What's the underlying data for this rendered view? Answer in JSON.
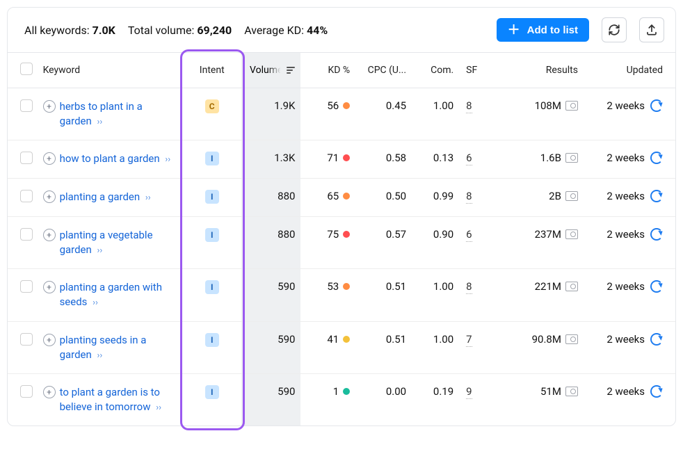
{
  "summary": {
    "all_keywords_label": "All keywords:",
    "all_keywords_value": "7.0K",
    "total_volume_label": "Total volume:",
    "total_volume_value": "69,240",
    "avg_kd_label": "Average KD:",
    "avg_kd_value": "44%"
  },
  "actions": {
    "add_to_list": "Add to list"
  },
  "columns": {
    "keyword": "Keyword",
    "intent": "Intent",
    "volume": "Volume",
    "kd": "KD %",
    "cpc": "CPC (U...",
    "com": "Com.",
    "sf": "SF",
    "results": "Results",
    "updated": "Updated"
  },
  "colors": {
    "kd_green": "#1abc9c",
    "kd_yellow": "#f3c13a",
    "kd_orange": "#ff8c42",
    "kd_red": "#ff4e50"
  },
  "rows": [
    {
      "keyword": "herbs to plant in a garden",
      "intent": "C",
      "volume": "1.9K",
      "kd": "56",
      "kd_color": "kd_orange",
      "cpc": "0.45",
      "com": "1.00",
      "sf": "8",
      "results": "108M",
      "updated": "2 weeks"
    },
    {
      "keyword": "how to plant a garden",
      "intent": "I",
      "volume": "1.3K",
      "kd": "71",
      "kd_color": "kd_red",
      "cpc": "0.58",
      "com": "0.13",
      "sf": "6",
      "results": "1.6B",
      "updated": "2 weeks"
    },
    {
      "keyword": "planting a garden",
      "intent": "I",
      "volume": "880",
      "kd": "65",
      "kd_color": "kd_orange",
      "cpc": "0.50",
      "com": "0.99",
      "sf": "8",
      "results": "2B",
      "updated": "2 weeks"
    },
    {
      "keyword": "planting a vegetable garden",
      "intent": "I",
      "volume": "880",
      "kd": "75",
      "kd_color": "kd_red",
      "cpc": "0.57",
      "com": "0.90",
      "sf": "6",
      "results": "237M",
      "updated": "2 weeks"
    },
    {
      "keyword": "planting a garden with seeds",
      "intent": "I",
      "volume": "590",
      "kd": "53",
      "kd_color": "kd_orange",
      "cpc": "0.51",
      "com": "1.00",
      "sf": "8",
      "results": "221M",
      "updated": "2 weeks"
    },
    {
      "keyword": "planting seeds in a garden",
      "intent": "I",
      "volume": "590",
      "kd": "41",
      "kd_color": "kd_yellow",
      "cpc": "0.51",
      "com": "1.00",
      "sf": "7",
      "results": "90.8M",
      "updated": "2 weeks"
    },
    {
      "keyword": "to plant a garden is to believe in tomorrow",
      "intent": "I",
      "volume": "590",
      "kd": "1",
      "kd_color": "kd_green",
      "cpc": "0.00",
      "com": "0.19",
      "sf": "9",
      "results": "51M",
      "updated": "2 weeks"
    }
  ]
}
